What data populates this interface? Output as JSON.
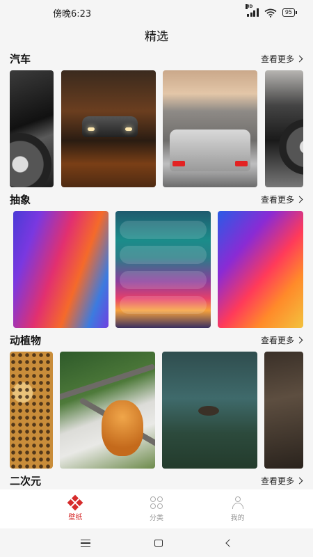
{
  "status_bar": {
    "time": "傍晚6:23",
    "network": "HD",
    "battery": "95"
  },
  "page": {
    "title": "精选"
  },
  "sections": [
    {
      "title": "汽车",
      "more": "查看更多"
    },
    {
      "title": "抽象",
      "more": "查看更多"
    },
    {
      "title": "动植物",
      "more": "查看更多"
    },
    {
      "title": "二次元",
      "more": "查看更多"
    }
  ],
  "bottom_nav": {
    "items": [
      {
        "label": "壁纸",
        "icon": "wallpaper-icon",
        "active": true
      },
      {
        "label": "分类",
        "icon": "category-icon",
        "active": false
      },
      {
        "label": "我的",
        "icon": "profile-icon",
        "active": false
      }
    ]
  },
  "colors": {
    "accent": "#d62b2b",
    "background": "#f5f5f5",
    "inactive": "#999999"
  }
}
